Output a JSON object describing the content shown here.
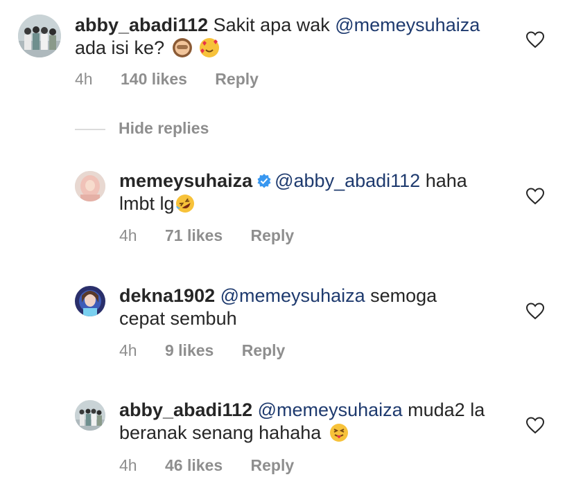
{
  "comment": {
    "username": "abby_abadi112",
    "text": "Sakit apa wak ",
    "mention": "@memeysuhaiza",
    "text2": "ada isi ke?",
    "time": "4h",
    "likes": "140 likes",
    "reply": "Reply"
  },
  "hide_replies": "Hide replies",
  "replies": [
    {
      "username": "memeysuhaiza",
      "verified": true,
      "mention": "@abby_abadi112",
      "text": " haha",
      "text2": "lmbt lg",
      "time": "4h",
      "likes": "71 likes",
      "reply": "Reply"
    },
    {
      "username": "dekna1902",
      "mention": "@memeysuhaiza",
      "text": " semoga",
      "text2": "cepat sembuh",
      "time": "4h",
      "likes": "9 likes",
      "reply": "Reply"
    },
    {
      "username": "abby_abadi112",
      "mention": "@memeysuhaiza",
      "text": " muda2 la",
      "text2": "beranak senang hahaha",
      "time": "4h",
      "likes": "46 likes",
      "reply": "Reply"
    }
  ],
  "icons": {
    "like": "heart-outline-icon",
    "verified": "verified-badge-icon",
    "emoji_monkey": "see-no-evil-monkey-emoji",
    "emoji_hearts": "smiling-face-with-hearts-emoji",
    "emoji_laugh": "rolling-on-floor-laughing-emoji",
    "emoji_tongue": "squinting-face-with-tongue-emoji"
  },
  "colors": {
    "text": "#262626",
    "secondary": "#8e8e8e",
    "mention": "#1e3a6e",
    "verified": "#3897f0",
    "divider": "#dbdbdb"
  }
}
